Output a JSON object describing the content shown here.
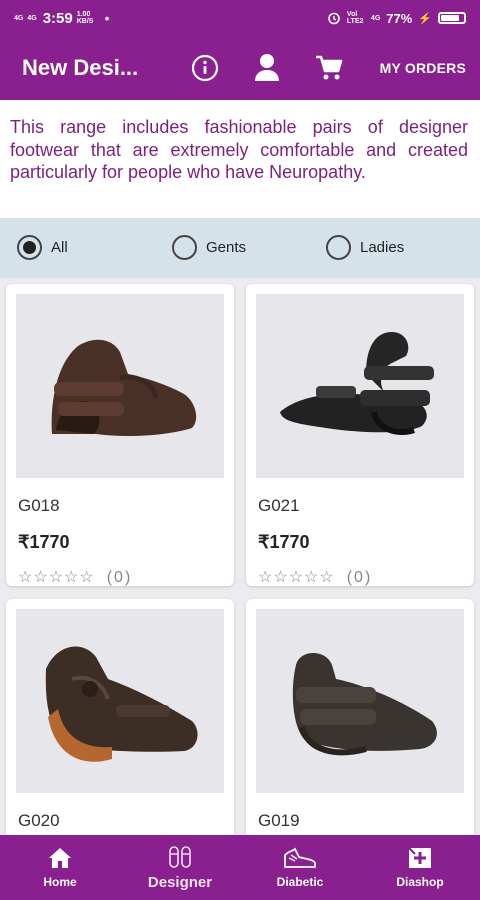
{
  "status_bar": {
    "network_left": "4G",
    "network_left2": "4G",
    "time": "3:59",
    "speed": "1.00 KB/S",
    "dot": "•",
    "network_right": "Vol LTE2",
    "network_right2": "4G",
    "battery_percent": "77%",
    "battery_level": 0.77
  },
  "app_bar": {
    "title": "New Desi...",
    "info_icon": "info-icon",
    "user_icon": "user-icon",
    "cart_icon": "cart-icon",
    "orders_label": "MY ORDERS"
  },
  "description": "This range includes fashionable pairs of designer footwear that are extremely comfortable and created particularly for people who have Neuropathy.",
  "filters": {
    "selected": "All",
    "options": [
      "All",
      "Gents",
      "Ladies"
    ]
  },
  "products": [
    {
      "code": "G018",
      "price": "₹1770",
      "rating_stars": "☆☆☆☆☆",
      "rating_count": "(0)"
    },
    {
      "code": "G021",
      "price": "₹1770",
      "rating_stars": "☆☆☆☆☆",
      "rating_count": "(0)"
    },
    {
      "code": "G020",
      "price": "",
      "rating_stars": "",
      "rating_count": ""
    },
    {
      "code": "G019",
      "price": "",
      "rating_stars": "",
      "rating_count": ""
    }
  ],
  "bottom_nav": {
    "active": "Designer",
    "items": [
      {
        "label": "Home",
        "icon": "home-icon"
      },
      {
        "label": "Designer",
        "icon": "sandal-icon"
      },
      {
        "label": "Diabetic",
        "icon": "shoe-icon"
      },
      {
        "label": "Diashop",
        "icon": "shop-icon"
      }
    ]
  },
  "colors": {
    "brand": "#8a1f8f",
    "description_text": "#7d1f7e",
    "filter_bar": "#d6e2ea"
  }
}
